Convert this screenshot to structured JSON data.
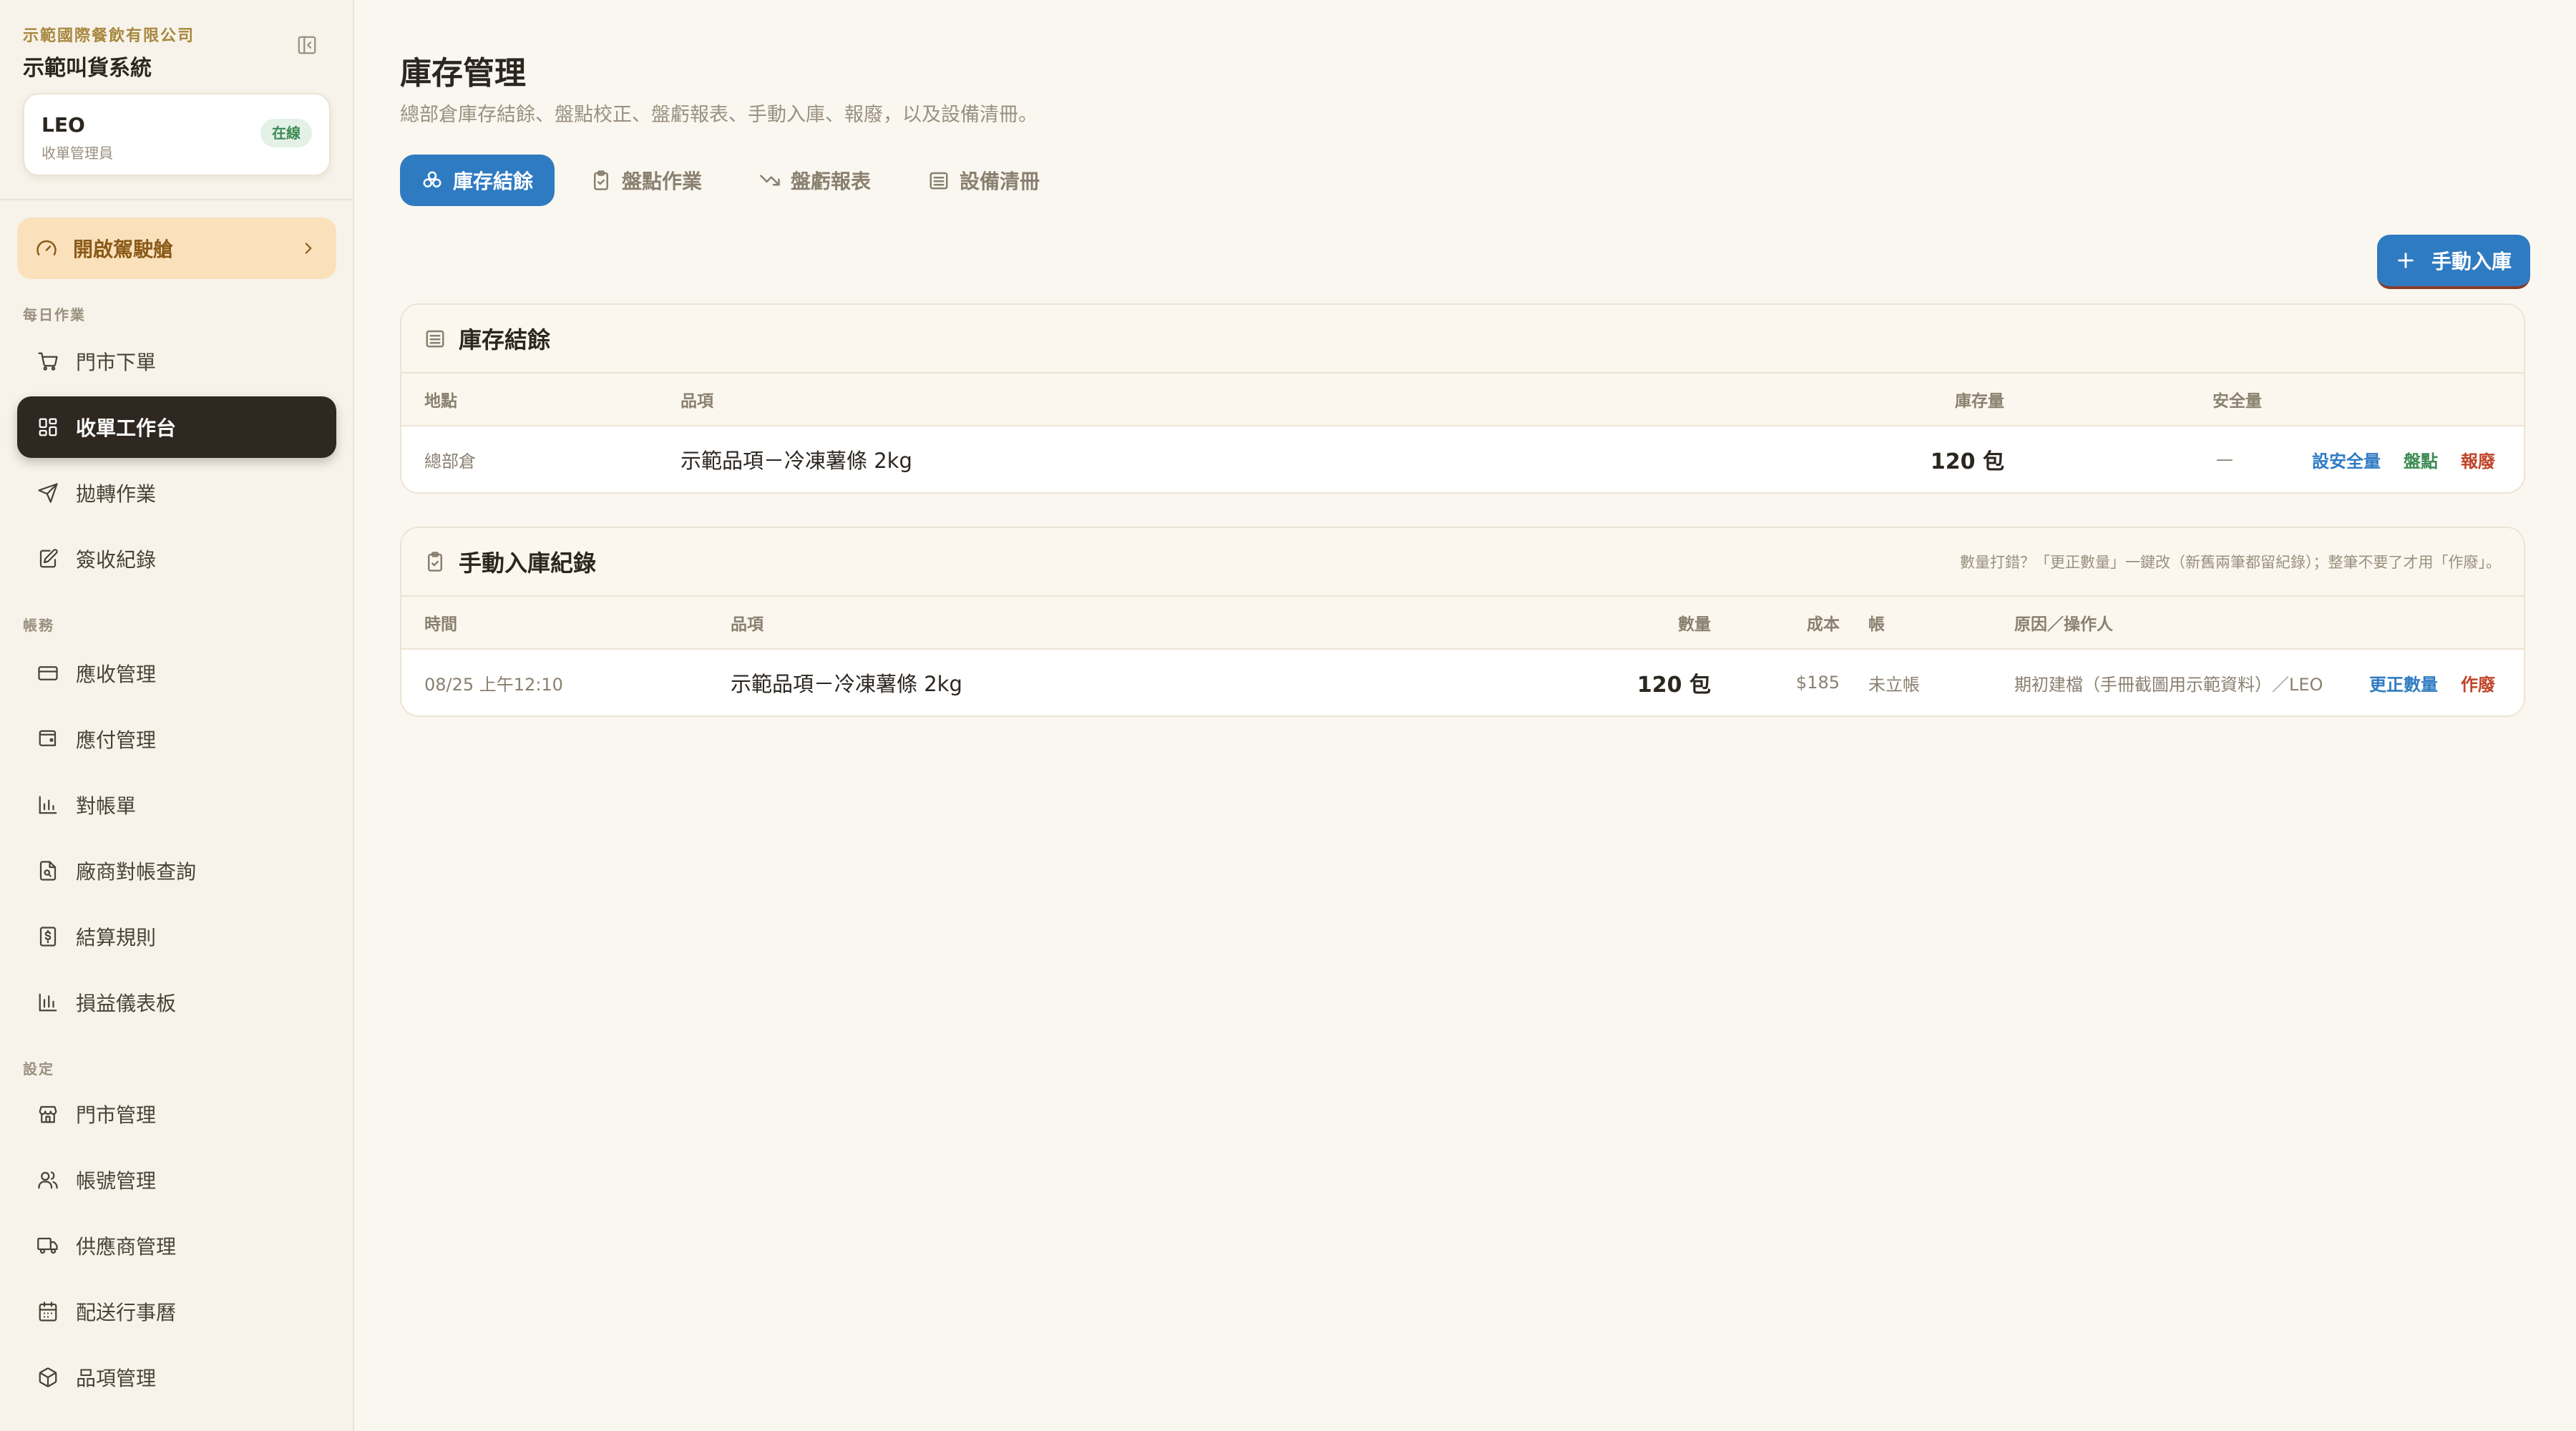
{
  "sidebar": {
    "company": "示範國際餐飲有限公司",
    "system_name": "示範叫貨系統",
    "user": {
      "name": "LEO",
      "role": "收單管理員",
      "status": "在線"
    },
    "cockpit_label": "開啟駕駛艙",
    "sections": {
      "daily": "每日作業",
      "accounts": "帳務",
      "settings": "設定"
    },
    "items": [
      {
        "label": "門市下單",
        "icon": "cart-icon"
      },
      {
        "label": "收單工作台",
        "icon": "grid-icon",
        "active": true
      },
      {
        "label": "拋轉作業",
        "icon": "send-icon"
      },
      {
        "label": "簽收紀錄",
        "icon": "sign-icon"
      },
      {
        "label": "應收管理",
        "icon": "card-icon"
      },
      {
        "label": "應付管理",
        "icon": "wallet-icon"
      },
      {
        "label": "對帳單",
        "icon": "bar-chart-icon"
      },
      {
        "label": "廠商對帳查詢",
        "icon": "file-search-icon"
      },
      {
        "label": "結算規則",
        "icon": "dollar-doc-icon"
      },
      {
        "label": "損益儀表板",
        "icon": "bar-chart-icon"
      },
      {
        "label": "門市管理",
        "icon": "store-icon"
      },
      {
        "label": "帳號管理",
        "icon": "users-icon"
      },
      {
        "label": "供應商管理",
        "icon": "truck-icon"
      },
      {
        "label": "配送行事曆",
        "icon": "calendar-icon"
      },
      {
        "label": "品項管理",
        "icon": "box-icon"
      }
    ]
  },
  "main": {
    "title": "庫存管理",
    "subtitle": "總部倉庫存結餘、盤點校正、盤虧報表、手動入庫、報廢，以及設備清冊。",
    "tabs": [
      {
        "label": "庫存結餘",
        "icon": "layers-icon",
        "active": true
      },
      {
        "label": "盤點作業",
        "icon": "clipboard-icon"
      },
      {
        "label": "盤虧報表",
        "icon": "trend-down-icon"
      },
      {
        "label": "設備清冊",
        "icon": "archive-icon"
      }
    ],
    "manual_in_label": "手動入庫",
    "balance": {
      "title": "庫存結餘",
      "headers": {
        "location": "地點",
        "item": "品項",
        "stock": "庫存量",
        "safety": "安全量"
      },
      "rows": [
        {
          "location": "總部倉",
          "item": "示範品項－冷凍薯條 2kg",
          "stock": "120 包",
          "safety": "—",
          "actions": {
            "set_safety": "設安全量",
            "count": "盤點",
            "scrap": "報廢"
          }
        }
      ]
    },
    "manual_log": {
      "title": "手動入庫紀錄",
      "note": "數量打錯？「更正數量」一鍵改（新舊兩筆都留紀錄）；整筆不要了才用「作廢」。",
      "headers": {
        "time": "時間",
        "item": "品項",
        "qty": "數量",
        "cost": "成本",
        "account": "帳",
        "reason": "原因／操作人"
      },
      "rows": [
        {
          "time": "08/25 上午12:10",
          "item": "示範品項－冷凍薯條 2kg",
          "qty": "120 包",
          "cost": "$185",
          "account": "未立帳",
          "reason": "期初建檔（手冊截圖用示範資料）／LEO",
          "actions": {
            "correct": "更正數量",
            "void": "作廢"
          }
        }
      ]
    }
  },
  "colors": {
    "accent_blue": "#2F7BC2",
    "active_nav": "#2E2820",
    "cockpit_bg": "#FAE1BC",
    "success_green": "#3B8A53",
    "danger_red": "#C0442A",
    "brand_gold": "#A8873F"
  }
}
